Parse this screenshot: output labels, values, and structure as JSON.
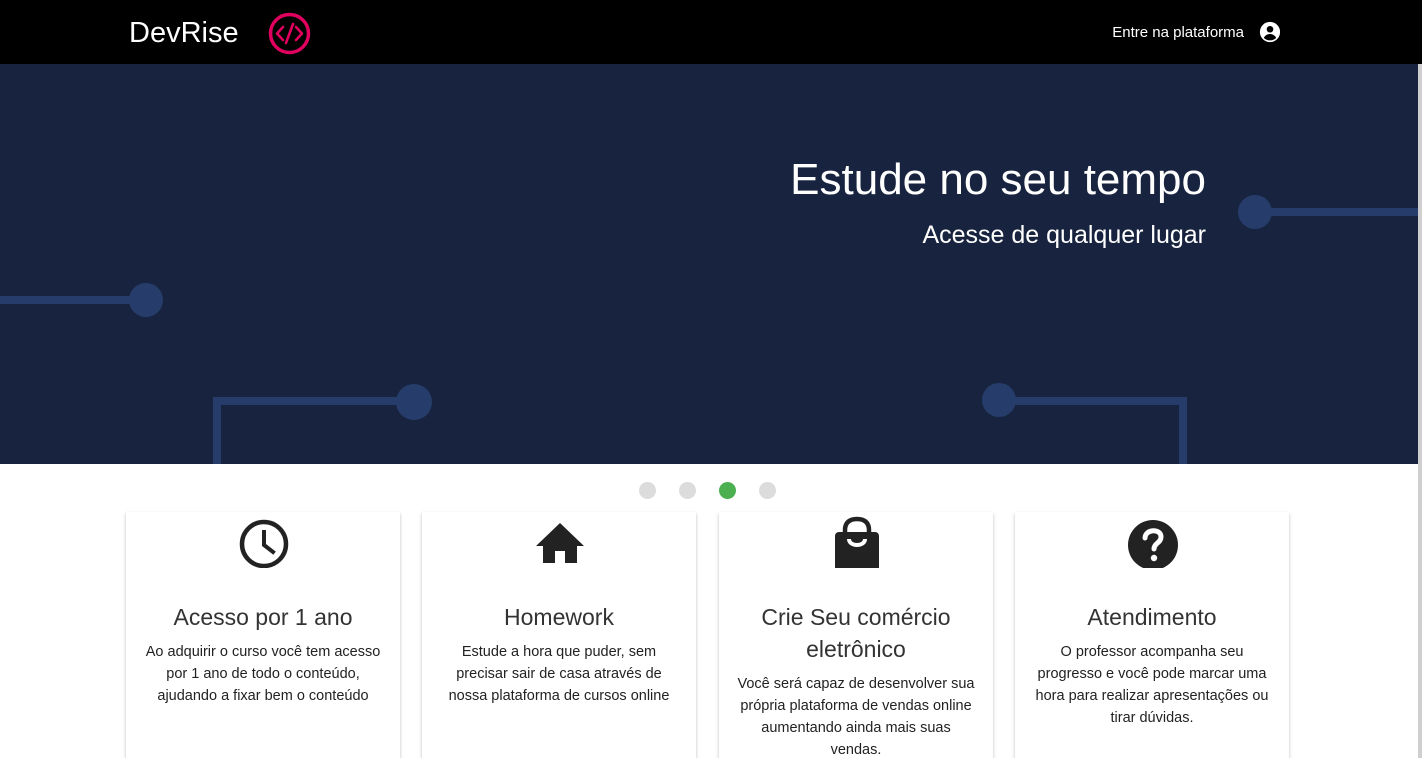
{
  "header": {
    "brand": "DevRise",
    "logo_icon": "code-circle-icon",
    "login_link": "Entre na plataforma",
    "account_icon": "account-circle-icon",
    "brand_color": "#e0005e"
  },
  "hero": {
    "title": "Estude no seu tempo",
    "subtitle": "Acesse de qualquer lugar",
    "background_color": "#18243f",
    "decoration_color": "#263d6b"
  },
  "carousel": {
    "slide_count": 4,
    "active_index": 2,
    "active_color": "#4caf50",
    "inactive_color": "#dcdcdc"
  },
  "cards": [
    {
      "icon": "clock-icon",
      "title": "Acesso por 1 ano",
      "text": "Ao adquirir o curso você tem acesso por 1 ano de todo o conteúdo, ajudando a fixar bem o conteúdo"
    },
    {
      "icon": "home-icon",
      "title": "Homework",
      "text": "Estude a hora que puder, sem precisar sair de casa através de nossa plataforma de cursos online"
    },
    {
      "icon": "shopping-bag-icon",
      "title": "Crie Seu comércio eletrônico",
      "text": "Você será capaz de desenvolver sua própria plataforma de vendas online aumentando ainda mais suas vendas."
    },
    {
      "icon": "help-circle-icon",
      "title": "Atendimento",
      "text": "O professor acompanha seu progresso e você pode marcar uma hora para realizar apresentações ou tirar dúvidas."
    }
  ]
}
